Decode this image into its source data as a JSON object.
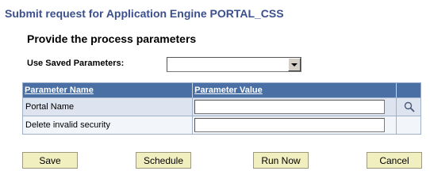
{
  "page": {
    "title": "Submit request for Application Engine PORTAL_CSS",
    "section_title": "Provide the process parameters"
  },
  "saved_parameters": {
    "label": "Use Saved Parameters:",
    "value": ""
  },
  "grid": {
    "headers": [
      "Parameter Name",
      "Parameter Value",
      ""
    ],
    "rows": [
      {
        "name": "Portal Name",
        "value": "",
        "has_lookup": true
      },
      {
        "name": "Delete invalid security",
        "value": "",
        "has_lookup": false
      }
    ]
  },
  "icons": {
    "lookup": "magnifier-search-icon",
    "dropdown": "dropdown-arrow-icon"
  },
  "buttons": {
    "save": "Save",
    "schedule": "Schedule",
    "run_now": "Run Now",
    "cancel": "Cancel"
  },
  "colors": {
    "title": "#3b4f8c",
    "grid_header": "#4a6fa5",
    "row_odd": "#dde3ef",
    "row_even": "#f2f5fa",
    "button": "#f1eec0"
  }
}
